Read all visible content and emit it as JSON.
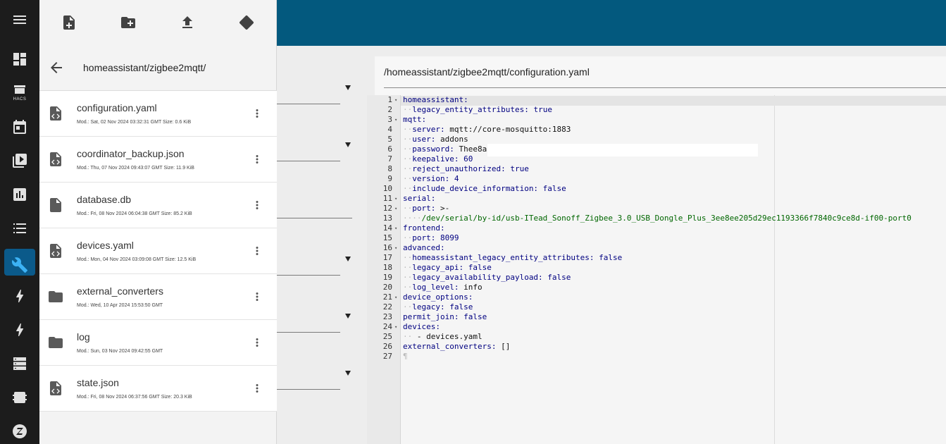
{
  "drawer": {
    "toolbar": {
      "new_file_icon": "file-plus-icon",
      "new_folder_icon": "folder-plus-icon",
      "upload_icon": "upload-icon",
      "git_icon": "git-icon"
    },
    "current_path": "homeassistant/zigbee2mqtt/",
    "files": [
      {
        "name": "configuration.yaml",
        "type": "code-file",
        "meta": "Mod.: Sat, 02 Nov 2024 03:32:31 GMT  Size: 0.6 KiB"
      },
      {
        "name": "coordinator_backup.json",
        "type": "code-file",
        "meta": "Mod.: Thu, 07 Nov 2024 09:43:07 GMT  Size: 11.9 KiB"
      },
      {
        "name": "database.db",
        "type": "file",
        "meta": "Mod.: Fri, 08 Nov 2024 06:04:38 GMT  Size: 85.2 KiB"
      },
      {
        "name": "devices.yaml",
        "type": "code-file",
        "meta": "Mod.: Mon, 04 Nov 2024 03:09:08 GMT  Size: 12.5 KiB"
      },
      {
        "name": "external_converters",
        "type": "folder",
        "meta": "Mod.: Wed, 10 Apr 2024 15:53:50 GMT"
      },
      {
        "name": "log",
        "type": "folder",
        "meta": "Mod.: Sun, 03 Nov 2024 09:42:55 GMT"
      },
      {
        "name": "state.json",
        "type": "code-file",
        "meta": "Mod.: Fri, 08 Nov 2024 06:37:56 GMT  Size: 20.3 KiB"
      }
    ]
  },
  "rail": {
    "items": [
      "menu-icon",
      "dashboard-icon",
      "hacs-icon",
      "calendar-icon",
      "media-icon",
      "chart-icon",
      "list-icon",
      "wrench-icon",
      "energy-icon",
      "bolt-icon",
      "server-icon",
      "chip-icon",
      "zigbee-icon"
    ],
    "hacs_label": "HACS"
  },
  "editor": {
    "path": "/homeassistant/zigbee2mqtt/configuration.yaml",
    "lines": [
      {
        "n": "1",
        "fold": "▾",
        "indent": "",
        "key": "homeassistant:",
        "val": "",
        "vclass": ""
      },
      {
        "n": "2",
        "fold": "",
        "indent": "··",
        "key": "legacy_entity_attributes:",
        "val": " true",
        "vclass": "b"
      },
      {
        "n": "3",
        "fold": "▾",
        "indent": "",
        "key": "mqtt:",
        "val": "",
        "vclass": ""
      },
      {
        "n": "4",
        "fold": "",
        "indent": "··",
        "key": "server:",
        "val": " mqtt://core-mosquitto:1883",
        "vclass": "v"
      },
      {
        "n": "5",
        "fold": "",
        "indent": "··",
        "key": "user:",
        "val": " addons",
        "vclass": "v"
      },
      {
        "n": "6",
        "fold": "",
        "indent": "··",
        "key": "password:",
        "val": " Thee8a",
        "vclass": "v"
      },
      {
        "n": "7",
        "fold": "",
        "indent": "··",
        "key": "keepalive:",
        "val": " 60",
        "vclass": "b"
      },
      {
        "n": "8",
        "fold": "",
        "indent": "··",
        "key": "reject_unauthorized:",
        "val": " true",
        "vclass": "b"
      },
      {
        "n": "9",
        "fold": "",
        "indent": "··",
        "key": "version:",
        "val": " 4",
        "vclass": "b"
      },
      {
        "n": "10",
        "fold": "",
        "indent": "··",
        "key": "include_device_information:",
        "val": " false",
        "vclass": "b"
      },
      {
        "n": "11",
        "fold": "▾",
        "indent": "",
        "key": "serial:",
        "val": "",
        "vclass": ""
      },
      {
        "n": "12",
        "fold": "▾",
        "indent": "··",
        "key": "port:",
        "val": " >-",
        "vclass": "v"
      },
      {
        "n": "13",
        "fold": "",
        "indent": "····",
        "key": "",
        "val": "/dev/serial/by-id/usb-ITead_Sonoff_Zigbee_3.0_USB_Dongle_Plus_3ee8ee205d29ec1193366f7840c9ce8d-if00-port0",
        "vclass": "s"
      },
      {
        "n": "14",
        "fold": "▾",
        "indent": "",
        "key": "frontend:",
        "val": "",
        "vclass": ""
      },
      {
        "n": "15",
        "fold": "",
        "indent": "··",
        "key": "port:",
        "val": " 8099",
        "vclass": "b"
      },
      {
        "n": "16",
        "fold": "▾",
        "indent": "",
        "key": "advanced:",
        "val": "",
        "vclass": ""
      },
      {
        "n": "17",
        "fold": "",
        "indent": "··",
        "key": "homeassistant_legacy_entity_attributes:",
        "val": " false",
        "vclass": "b"
      },
      {
        "n": "18",
        "fold": "",
        "indent": "··",
        "key": "legacy_api:",
        "val": " false",
        "vclass": "b"
      },
      {
        "n": "19",
        "fold": "",
        "indent": "··",
        "key": "legacy_availability_payload:",
        "val": " false",
        "vclass": "b"
      },
      {
        "n": "20",
        "fold": "",
        "indent": "··",
        "key": "log_level:",
        "val": " info",
        "vclass": "v"
      },
      {
        "n": "21",
        "fold": "▾",
        "indent": "",
        "key": "device_options:",
        "val": "",
        "vclass": ""
      },
      {
        "n": "22",
        "fold": "",
        "indent": "··",
        "key": "legacy:",
        "val": " false",
        "vclass": "b"
      },
      {
        "n": "23",
        "fold": "",
        "indent": "",
        "key": "permit_join:",
        "val": " false",
        "vclass": "b"
      },
      {
        "n": "24",
        "fold": "▾",
        "indent": "",
        "key": "devices:",
        "val": "",
        "vclass": ""
      },
      {
        "n": "25",
        "fold": "",
        "indent": "··",
        "key": "",
        "val": " - devices.yaml",
        "vclass": "v"
      },
      {
        "n": "26",
        "fold": "",
        "indent": "",
        "key": "external_converters:",
        "val": " []",
        "vclass": "v"
      },
      {
        "n": "27",
        "fold": "",
        "indent": "",
        "key": "",
        "val": "¶",
        "vclass": "ws"
      }
    ]
  },
  "colors": {
    "header_blue": "#03597e",
    "rail_bg": "#1c1c1c",
    "active_accent": "#3cb2f5"
  }
}
